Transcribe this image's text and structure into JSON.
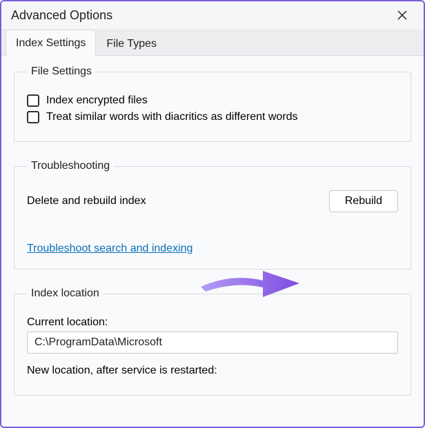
{
  "window": {
    "title": "Advanced Options"
  },
  "tabs": {
    "index_settings": "Index Settings",
    "file_types": "File Types"
  },
  "file_settings": {
    "legend": "File Settings",
    "index_encrypted": "Index encrypted files",
    "diacritics": "Treat similar words with diacritics as different words"
  },
  "troubleshooting": {
    "legend": "Troubleshooting",
    "rebuild_label": "Delete and rebuild index",
    "rebuild_button": "Rebuild",
    "troubleshoot_link": "Troubleshoot search and indexing"
  },
  "index_location": {
    "legend": "Index location",
    "current_label": "Current location:",
    "current_value": "C:\\ProgramData\\Microsoft",
    "new_label": "New location, after service is restarted:"
  },
  "annotation": {
    "arrow_color": "#8a5cf0"
  }
}
